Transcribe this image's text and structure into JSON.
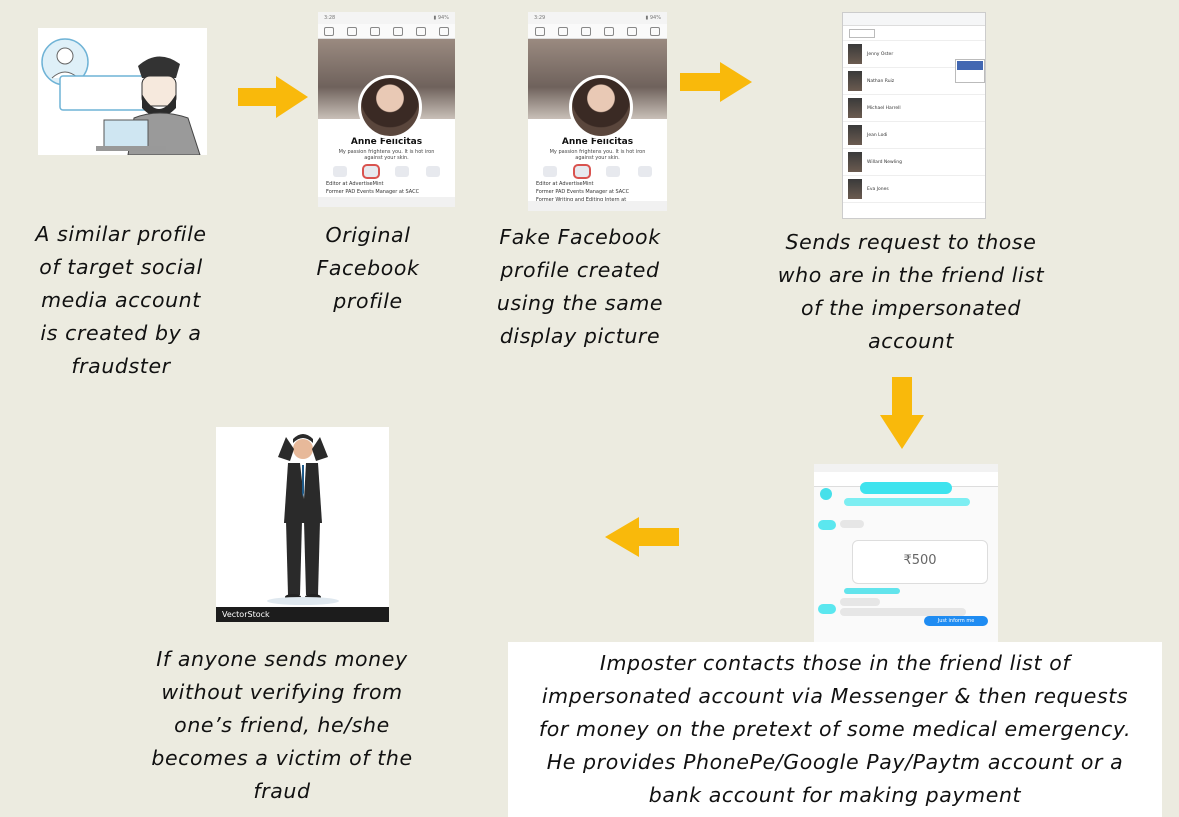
{
  "captions": {
    "step1": "A similar profile\nof target social\nmedia account\nis created by a\nfraudster",
    "step2": "Original\nFacebook\nprofile",
    "step3": "Fake  Facebook\nprofile  created\nusing the same\ndisplay picture",
    "step4": "Sends request to those\nwho are in the friend list\nof the impersonated\naccount",
    "step5": "Imposter contacts those in the friend list of\nimpersonated account via Messenger & then requests\nfor money on the pretext of some medical emergency.\nHe provides PhonePe/Google Pay/Paytm account or a\nbank account for making payment",
    "step6": "If anyone sends money\nwithout verifying from\none’s friend, he/she\nbecomes a victim of the\nfraud"
  },
  "profile": {
    "name": "Anne Felicitas",
    "bio": "My passion frightens you. It is hot iron against your skin.",
    "info1": "Editor at AdvertiseMint",
    "info2": "Former PAD Events Manager at SACC",
    "info3": "Former Writing and Editing Intern at"
  },
  "friends": {
    "names": [
      "Jenny Oster",
      "Nathan Ruiz",
      "Michael Harrell",
      "Jean Lodi",
      "Willard Newling",
      "Eva Jones"
    ]
  },
  "messenger": {
    "amount": "500",
    "reply": "Just inform me"
  },
  "watermark": "VectorStock",
  "colors": {
    "background": "#ecebe0",
    "arrow": "#f9b90b"
  }
}
